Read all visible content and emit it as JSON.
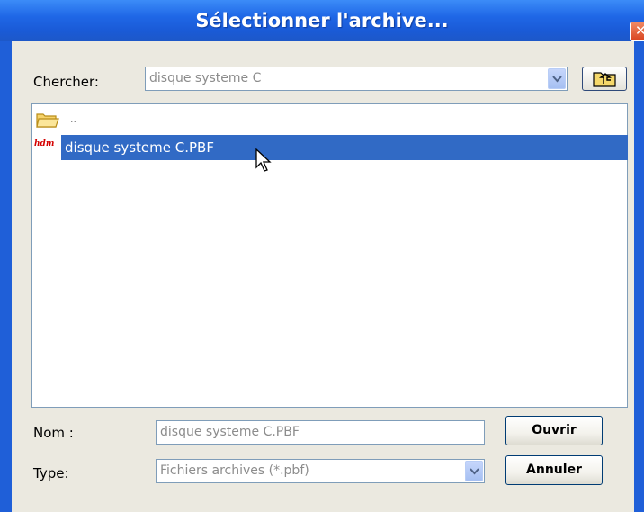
{
  "window": {
    "title": "Sélectionner l'archive...",
    "close_glyph": "✕"
  },
  "lookin": {
    "label": "Chercher:",
    "value": "disque systeme C"
  },
  "files": [
    {
      "name": "..",
      "icon": "folder-up-icon"
    },
    {
      "name": "disque systeme C.PBF",
      "icon": "pbf-file-icon",
      "icon_text": "hdm",
      "selected": true
    }
  ],
  "name_field": {
    "label": "Nom :",
    "value": "disque systeme C.PBF"
  },
  "type_field": {
    "label": "Type:",
    "value": "Fichiers archives (*.pbf)"
  },
  "buttons": {
    "open": "Ouvrir",
    "cancel": "Annuler"
  },
  "colors": {
    "titlebar": "#1f5fd8",
    "selection": "#316ac5",
    "dialog_bg": "#ebe9e0"
  }
}
